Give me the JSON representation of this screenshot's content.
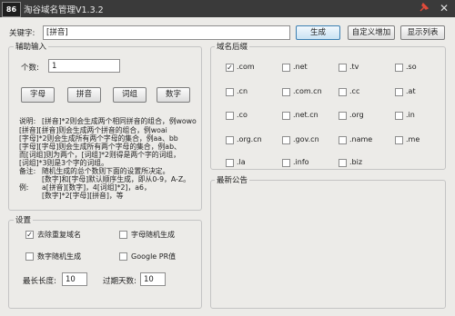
{
  "window": {
    "logo": "86",
    "title": "淘谷域名管理V1.3.2",
    "pin_icon": "pin-icon",
    "close_icon": "close-icon"
  },
  "keyword": {
    "label": "关键字:",
    "value": "[拼音]"
  },
  "toolbar": {
    "generate": "生成",
    "custom_add": "自定义增加",
    "show_list": "显示列表"
  },
  "aux": {
    "title": "辅助输入",
    "count_label": "个数:",
    "count_value": "1",
    "buttons": [
      "字母",
      "拼音",
      "词组",
      "数字"
    ],
    "help_label": "说明:",
    "help_lines": [
      "[拼音]*2则会生成两个相同拼音的组合，例wowo",
      "[拼音][拼音]则会生成两个拼音的组合，例woai",
      "[字母]*2则会生成所有两个字母的集合，例aa、bb",
      "[字母][字母]则会生成所有两个字母的集合，例ab、",
      "而[词组]则为两个，[词组]*2则得是两个字的词组，",
      "[词组]*3则是3个字的词组。"
    ],
    "note_label": "备注:",
    "note_lines": [
      "随机生成的总个数则下面的设置所决定。",
      "[数字]和[字母]默认顺序生成，即从0-9，A-Z。"
    ],
    "example_label": "例:",
    "example_lines": [
      "a[拼音][数字]，4[词组]*2]，a6，",
      "[数字]*2[字母][拼音]，等"
    ]
  },
  "settings": {
    "title": "设置",
    "dedupe": {
      "label": "去除重复域名",
      "checked": true
    },
    "letter_random": {
      "label": "字母随机生成",
      "checked": false
    },
    "digit_random": {
      "label": "数字随机生成",
      "checked": false
    },
    "google_pr": {
      "label": "Google PR值",
      "checked": false
    },
    "max_len_label": "最长长度:",
    "max_len_value": "10",
    "expire_label": "过期天数:",
    "expire_value": "10"
  },
  "suffix": {
    "title": "域名后缀",
    "items": [
      {
        "label": ".com",
        "checked": true
      },
      {
        "label": ".net",
        "checked": false
      },
      {
        "label": ".tv",
        "checked": false
      },
      {
        "label": ".so",
        "checked": false
      },
      {
        "label": ".cn",
        "checked": false
      },
      {
        "label": ".com.cn",
        "checked": false
      },
      {
        "label": ".cc",
        "checked": false
      },
      {
        "label": ".at",
        "checked": false
      },
      {
        "label": ".co",
        "checked": false
      },
      {
        "label": ".net.cn",
        "checked": false
      },
      {
        "label": ".org",
        "checked": false
      },
      {
        "label": ".in",
        "checked": false
      },
      {
        "label": ".org.cn",
        "checked": false
      },
      {
        "label": ".gov.cn",
        "checked": false
      },
      {
        "label": ".name",
        "checked": false
      },
      {
        "label": ".me",
        "checked": false
      },
      {
        "label": ".la",
        "checked": false
      },
      {
        "label": ".info",
        "checked": false
      },
      {
        "label": ".biz",
        "checked": false
      }
    ]
  },
  "announce": {
    "title": "最新公告"
  }
}
